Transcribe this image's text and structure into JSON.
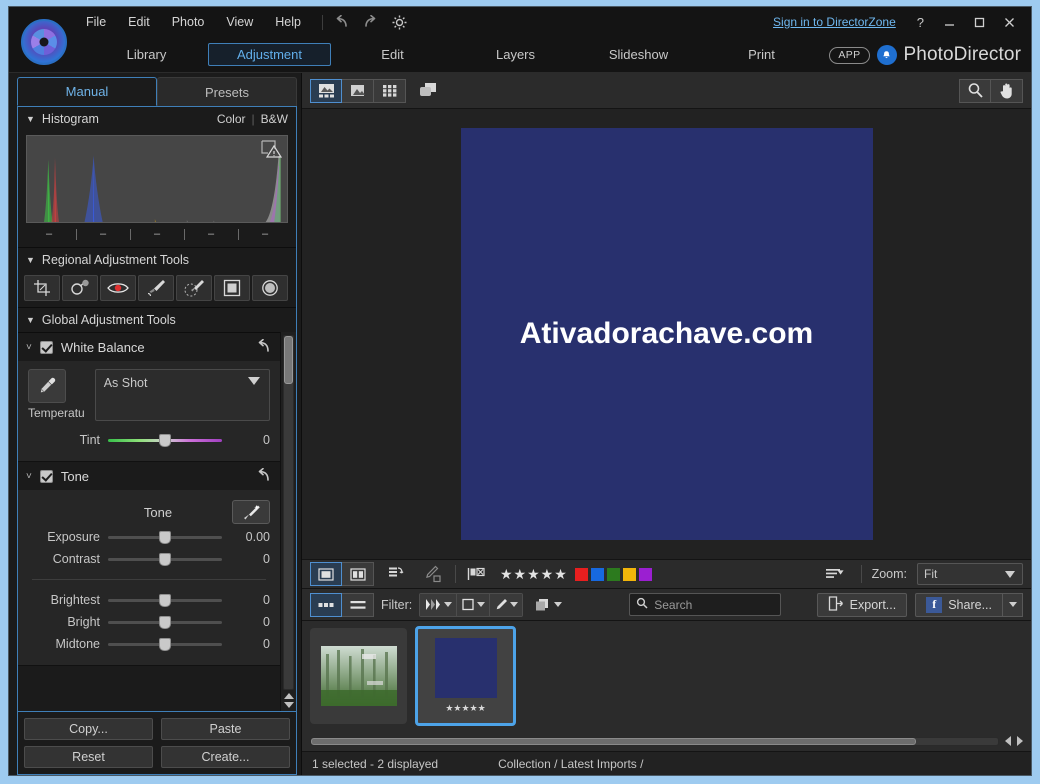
{
  "titlebar": {
    "menu": [
      "File",
      "Edit",
      "Photo",
      "View",
      "Help"
    ],
    "undo_icon": "undo-icon",
    "redo_icon": "redo-icon",
    "settings_icon": "gear-icon",
    "signin": "Sign in to DirectorZone",
    "help": "?",
    "minimize": "—",
    "maximize": "☐",
    "close": "✕"
  },
  "modulebar": {
    "modules": [
      "Library",
      "Adjustment",
      "Edit",
      "Layers",
      "Slideshow",
      "Print"
    ],
    "active_module": "Adjustment",
    "app_badge": "APP",
    "bell_icon": "notification-bell-icon",
    "brand": "PhotoDirector",
    "accent": "#62aeea"
  },
  "left_panel": {
    "tabs": [
      "Manual",
      "Presets"
    ],
    "active_tab": "Manual",
    "histogram": {
      "title": "Histogram",
      "modes": [
        "Color",
        "B&W"
      ],
      "separator": "|",
      "tick_labels": [
        "–",
        "–",
        "–",
        "–",
        "–"
      ],
      "clip_warning_icon": "clipping-warning-icon"
    },
    "regional": {
      "title": "Regional Adjustment Tools",
      "tools": [
        {
          "name": "crop-rotate-tool",
          "label": "Crop & Rotate"
        },
        {
          "name": "remove-object-tool",
          "label": "Remove Object"
        },
        {
          "name": "red-eye-removal-tool",
          "label": "Red-Eye Removal"
        },
        {
          "name": "brush-tool",
          "label": "Brush"
        },
        {
          "name": "smart-brush-tool",
          "label": "Smart Brush"
        },
        {
          "name": "gradient-mask-tool",
          "label": "Gradient Mask"
        },
        {
          "name": "radial-mask-tool",
          "label": "Radial Mask"
        }
      ]
    },
    "global": {
      "title": "Global Adjustment Tools",
      "white_balance": {
        "title": "White Balance",
        "enabled": true,
        "reset_icon": "reset-arrow-icon",
        "eyedropper_icon": "eyedropper-icon",
        "preset_value": "As Shot",
        "temperature_label": "Temperatu",
        "tint_label": "Tint",
        "tint_value": "0"
      },
      "tone": {
        "title": "Tone",
        "enabled": true,
        "reset_icon": "reset-arrow-icon",
        "section_label": "Tone",
        "auto_tone_icon": "magic-wand-icon",
        "sliders": [
          {
            "label": "Exposure",
            "value": "0.00",
            "pos": 50
          },
          {
            "label": "Contrast",
            "value": "0",
            "pos": 50
          },
          {
            "label": "Brightest",
            "value": "0",
            "pos": 50
          },
          {
            "label": "Bright",
            "value": "0",
            "pos": 50
          },
          {
            "label": "Midtone",
            "value": "0",
            "pos": 50
          }
        ]
      }
    },
    "buttons": [
      "Copy...",
      "Paste",
      "Reset",
      "Create..."
    ]
  },
  "viewer_toolbar": {
    "view_modes": [
      {
        "name": "filmstrip-view-button",
        "active": true
      },
      {
        "name": "single-photo-view-button",
        "active": false
      },
      {
        "name": "grid-view-button",
        "active": false
      }
    ],
    "compare_icon": "compare-photos-icon",
    "zoom_tool_icon": "magnifier-icon",
    "pan_tool_icon": "hand-pan-icon"
  },
  "canvas": {
    "photo_text": "Ativadorachave.com",
    "photo_bg": "#28306e"
  },
  "strip_toolbar": {
    "view_single_icon": "single-pane-icon",
    "view_split_icon": "split-pane-icon",
    "rotate_icon": "rotate-icon",
    "draw_icon": "pencil-icon",
    "flag_icon": "flag-reject-icon",
    "stars": "★★★★★",
    "color_swatches": [
      "#e81f1f",
      "#1769e0",
      "#2c7a1e",
      "#f2b50a",
      "#9b1fd1"
    ],
    "sort_icon": "sort-options-icon",
    "zoom_label": "Zoom:",
    "zoom_value": "Fit"
  },
  "filter_toolbar": {
    "view_thumb_icon": "thumbnail-view-icon",
    "view_list_icon": "list-view-icon",
    "filter_label": "Filter:",
    "filter_flag_icon": "flag-filter-icon",
    "filter_rating_icon": "rating-filter-icon",
    "filter_edit_icon": "edit-filter-icon",
    "stack_icon": "stack-icon",
    "search_placeholder": "Search",
    "search_value": "",
    "search_icon": "search-icon",
    "clear_icon": "close-icon",
    "export_label": "Export...",
    "export_icon": "export-icon",
    "share_label": "Share...",
    "share_icon": "facebook-icon"
  },
  "filmstrip": {
    "thumbnails": [
      {
        "name": "thumbnail-forest",
        "selected": false,
        "stars": "",
        "type": "photo"
      },
      {
        "name": "thumbnail-ativadorachave",
        "selected": true,
        "stars": "★★★★★",
        "type": "blue"
      }
    ]
  },
  "statusbar": {
    "selection": "1 selected - 2 displayed",
    "path": "Collection / Latest Imports /"
  }
}
